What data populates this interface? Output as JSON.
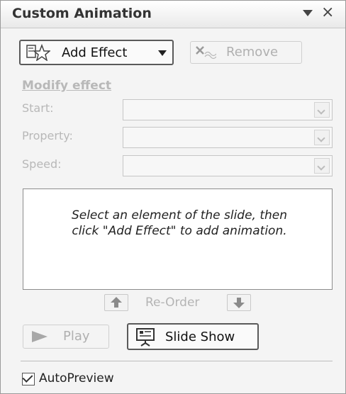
{
  "panel": {
    "title": "Custom Animation",
    "dropdown_icon": "triangle-down-icon",
    "close_glyph": "×"
  },
  "toolbar": {
    "add_effect": {
      "label": "Add Effect",
      "icon": "star-effect-icon",
      "dropdown_icon": "triangle-down-icon"
    },
    "remove": {
      "label": "Remove",
      "icon": "remove-effect-icon",
      "enabled": false
    }
  },
  "modify": {
    "heading": "Modify effect",
    "fields": [
      {
        "label": "Start:",
        "value": ""
      },
      {
        "label": "Property:",
        "value": ""
      },
      {
        "label": "Speed:",
        "value": ""
      }
    ]
  },
  "list": {
    "hint_line1": "Select an element of the slide, then",
    "hint_line2": "click \"Add Effect\" to add animation."
  },
  "reorder": {
    "label": "Re-Order",
    "up_icon": "arrow-up-icon",
    "down_icon": "arrow-down-icon",
    "enabled": false
  },
  "playback": {
    "play": {
      "label": "Play",
      "icon": "play-icon",
      "enabled": false
    },
    "slideshow": {
      "label": "Slide Show",
      "icon": "slideshow-icon"
    }
  },
  "autopreview": {
    "label": "AutoPreview",
    "checked": true
  }
}
